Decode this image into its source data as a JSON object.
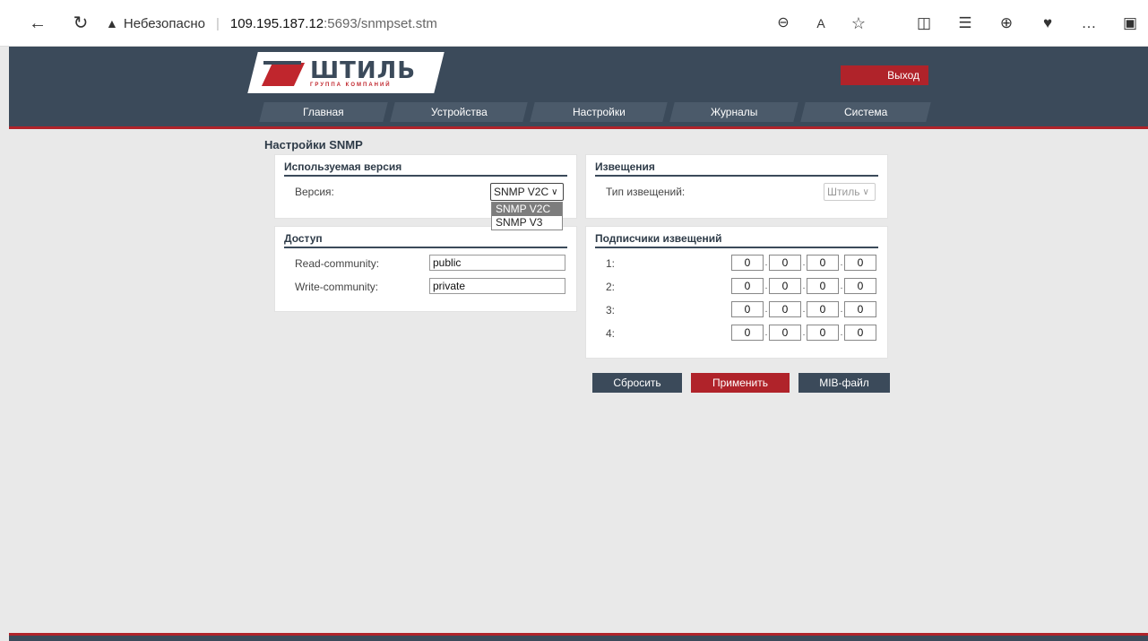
{
  "browser": {
    "security_label": "Небезопасно",
    "url_host": "109.195.187.12",
    "url_path": ":5693/snmpset.stm"
  },
  "header": {
    "logo_title": "ШТИЛЬ",
    "logo_subtitle": "ГРУППА КОМПАНИЙ",
    "exit_label": "Выход",
    "menu": [
      "Главная",
      "Устройства",
      "Настройки",
      "Журналы",
      "Система"
    ]
  },
  "page": {
    "title": "Настройки SNMP"
  },
  "version_panel": {
    "title": "Используемая версия",
    "version_label": "Версия:",
    "selected": "SNMP V2C",
    "options": [
      "SNMP V2C",
      "SNMP V3"
    ]
  },
  "notify_panel": {
    "title": "Извещения",
    "type_label": "Тип извещений:",
    "type_value": "Штиль"
  },
  "access_panel": {
    "title": "Доступ",
    "read_label": "Read-community:",
    "read_value": "public",
    "write_label": "Write-community:",
    "write_value": "private"
  },
  "subscribers_panel": {
    "title": "Подписчики извещений",
    "rows": [
      {
        "label": "1:",
        "ip": [
          "0",
          "0",
          "0",
          "0"
        ]
      },
      {
        "label": "2:",
        "ip": [
          "0",
          "0",
          "0",
          "0"
        ]
      },
      {
        "label": "3:",
        "ip": [
          "0",
          "0",
          "0",
          "0"
        ]
      },
      {
        "label": "4:",
        "ip": [
          "0",
          "0",
          "0",
          "0"
        ]
      }
    ]
  },
  "buttons": {
    "reset": "Сбросить",
    "apply": "Применить",
    "mib": "MIB-файл"
  },
  "colors": {
    "header_bg": "#3b4a5a",
    "accent_red": "#b0232a",
    "page_bg": "#e9e9e9"
  }
}
